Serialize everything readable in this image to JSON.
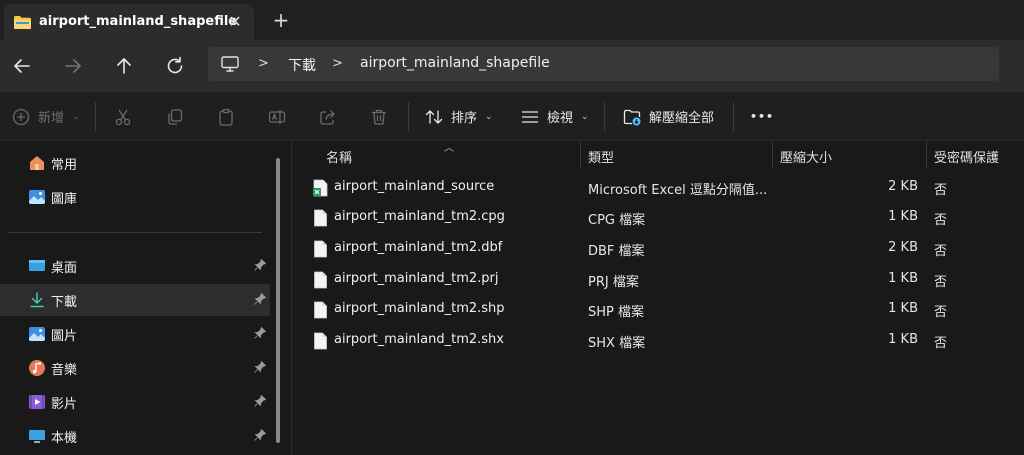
{
  "window": {
    "tab_title": "airport_mainland_shapefile",
    "close_glyph": "✕",
    "new_tab_glyph": "+"
  },
  "address": {
    "crumbs": [
      "下載",
      "airport_mainland_shapefile"
    ],
    "separator": ">"
  },
  "toolbar": {
    "new_label": "新增",
    "sort_label": "排序",
    "view_label": "檢視",
    "extract_label": "解壓縮全部",
    "more_label": "•••"
  },
  "sidebar": {
    "items": [
      {
        "label": "常用",
        "icon": "home-icon"
      },
      {
        "label": "圖庫",
        "icon": "gallery-icon"
      },
      {
        "label": "桌面",
        "icon": "desktop-icon"
      },
      {
        "label": "下載",
        "icon": "download-icon"
      },
      {
        "label": "圖片",
        "icon": "pictures-icon"
      },
      {
        "label": "音樂",
        "icon": "music-icon"
      },
      {
        "label": "影片",
        "icon": "videos-icon"
      },
      {
        "label": "本機",
        "icon": "this-pc-icon"
      }
    ],
    "active": "下載"
  },
  "columns": {
    "name": "名稱",
    "type": "類型",
    "size": "壓縮大小",
    "password": "受密碼保護"
  },
  "files": [
    {
      "name": "airport_mainland_source",
      "type": "Microsoft Excel 逗點分隔值...",
      "size": "2 KB",
      "password": "否",
      "icon": "excel-csv-icon"
    },
    {
      "name": "airport_mainland_tm2.cpg",
      "type": "CPG 檔案",
      "size": "1 KB",
      "password": "否",
      "icon": "file-icon"
    },
    {
      "name": "airport_mainland_tm2.dbf",
      "type": "DBF 檔案",
      "size": "2 KB",
      "password": "否",
      "icon": "file-icon"
    },
    {
      "name": "airport_mainland_tm2.prj",
      "type": "PRJ 檔案",
      "size": "1 KB",
      "password": "否",
      "icon": "file-icon"
    },
    {
      "name": "airport_mainland_tm2.shp",
      "type": "SHP 檔案",
      "size": "1 KB",
      "password": "否",
      "icon": "file-icon"
    },
    {
      "name": "airport_mainland_tm2.shx",
      "type": "SHX 檔案",
      "size": "1 KB",
      "password": "否",
      "icon": "file-icon"
    }
  ],
  "colors": {
    "accent": "#4cc2ff",
    "folder": "#f8c94b",
    "excel": "#1f9e58"
  }
}
